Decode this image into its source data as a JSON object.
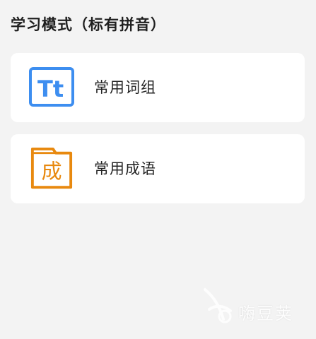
{
  "section": {
    "title": "学习模式（标有拼音）"
  },
  "cards": [
    {
      "label": "常用词组",
      "icon": "text-size-icon",
      "icon_text": "Tt",
      "color": "#3d8ef0"
    },
    {
      "label": "常用成语",
      "icon": "idiom-book-icon",
      "icon_text": "成",
      "color": "#e8890f"
    }
  ],
  "watermark": {
    "text": "嗨豆荚"
  }
}
